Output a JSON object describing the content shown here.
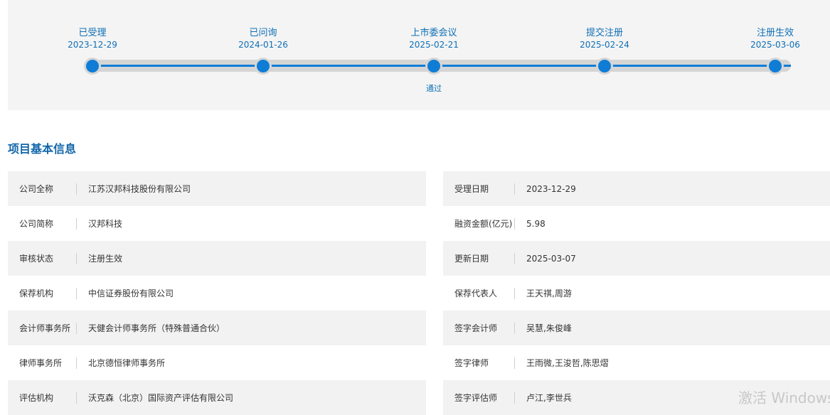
{
  "timeline": {
    "steps": [
      {
        "name": "已受理",
        "date": "2023-12-29",
        "note": ""
      },
      {
        "name": "已问询",
        "date": "2024-01-26",
        "note": ""
      },
      {
        "name": "上市委会议",
        "date": "2025-02-21",
        "note": "通过"
      },
      {
        "name": "提交注册",
        "date": "2025-02-24",
        "note": ""
      },
      {
        "name": "注册生效",
        "date": "2025-03-06",
        "note": ""
      }
    ]
  },
  "section": {
    "title": "项目基本信息"
  },
  "info": {
    "left": [
      {
        "label": "公司全称",
        "value": "江苏汉邦科技股份有限公司"
      },
      {
        "label": "公司简称",
        "value": "汉邦科技"
      },
      {
        "label": "审核状态",
        "value": "注册生效"
      },
      {
        "label": "保荐机构",
        "value": "中信证券股份有限公司"
      },
      {
        "label": "会计师事务所",
        "value": "天健会计师事务所（特殊普通合伙）"
      },
      {
        "label": "律师事务所",
        "value": "北京德恒律师事务所"
      },
      {
        "label": "评估机构",
        "value": "沃克森（北京）国际资产评估有限公司"
      }
    ],
    "right": [
      {
        "label": "受理日期",
        "value": "2023-12-29"
      },
      {
        "label": "融资金额(亿元)",
        "value": "5.98"
      },
      {
        "label": "更新日期",
        "value": "2025-03-07"
      },
      {
        "label": "保荐代表人",
        "value": "王天祺,周游"
      },
      {
        "label": "签字会计师",
        "value": "吴慧,朱俊峰"
      },
      {
        "label": "签字律师",
        "value": "王雨微,王浚哲,陈思熠"
      },
      {
        "label": "签字评估师",
        "value": "卢江,李世兵"
      }
    ]
  },
  "watermark": {
    "text": "激活 Windows"
  }
}
